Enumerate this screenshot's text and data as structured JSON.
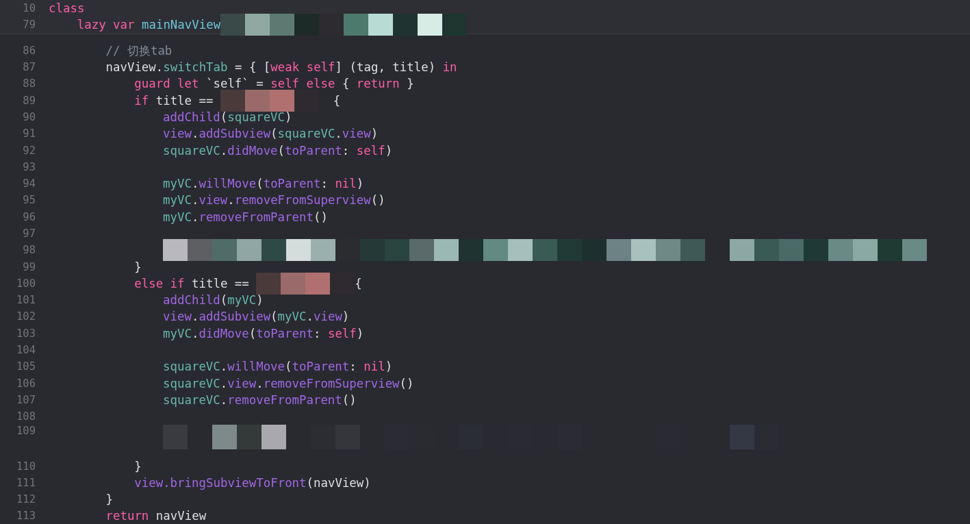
{
  "sticky_lines": [
    {
      "number": "10",
      "tokens": [
        {
          "kind": "kw",
          "text": "class"
        }
      ]
    },
    {
      "number": "79",
      "tokens": [
        {
          "kind": "kw",
          "text": "    lazy var "
        },
        {
          "kind": "blue",
          "text": "mainNavView"
        },
        {
          "kind": "mosaic-medium"
        }
      ]
    }
  ],
  "lines": [
    {
      "number": "86",
      "tokens": [
        {
          "kind": "comment",
          "text": "        // 切换tab"
        }
      ]
    },
    {
      "number": "87",
      "tokens": [
        {
          "kind": "plain",
          "text": "        navView."
        },
        {
          "kind": "teal",
          "text": "switchTab"
        },
        {
          "kind": "plain",
          "text": " = { ["
        },
        {
          "kind": "kw",
          "text": "weak self"
        },
        {
          "kind": "plain",
          "text": "] (tag, title) "
        },
        {
          "kind": "kw",
          "text": "in"
        }
      ]
    },
    {
      "number": "88",
      "tokens": [
        {
          "kind": "kw",
          "text": "            guard let"
        },
        {
          "kind": "plain",
          "text": " `self` = "
        },
        {
          "kind": "kw",
          "text": "self else"
        },
        {
          "kind": "plain",
          "text": " { "
        },
        {
          "kind": "kw",
          "text": "return"
        },
        {
          "kind": "plain",
          "text": " }"
        }
      ]
    },
    {
      "number": "89",
      "tokens": [
        {
          "kind": "kw",
          "text": "            if"
        },
        {
          "kind": "plain",
          "text": " title == "
        },
        {
          "kind": "mosaic-small"
        },
        {
          "kind": "plain",
          "text": "  {"
        }
      ]
    },
    {
      "number": "90",
      "tokens": [
        {
          "kind": "purple",
          "text": "                addChild"
        },
        {
          "kind": "plain",
          "text": "("
        },
        {
          "kind": "teal",
          "text": "squareVC"
        },
        {
          "kind": "plain",
          "text": ")"
        }
      ]
    },
    {
      "number": "91",
      "tokens": [
        {
          "kind": "purple",
          "text": "                view"
        },
        {
          "kind": "plain",
          "text": "."
        },
        {
          "kind": "purple",
          "text": "addSubview"
        },
        {
          "kind": "plain",
          "text": "("
        },
        {
          "kind": "teal",
          "text": "squareVC"
        },
        {
          "kind": "plain",
          "text": "."
        },
        {
          "kind": "purple",
          "text": "view"
        },
        {
          "kind": "plain",
          "text": ")"
        }
      ]
    },
    {
      "number": "92",
      "tokens": [
        {
          "kind": "teal",
          "text": "                squareVC"
        },
        {
          "kind": "plain",
          "text": "."
        },
        {
          "kind": "purple",
          "text": "didMove"
        },
        {
          "kind": "plain",
          "text": "("
        },
        {
          "kind": "purple",
          "text": "toParent"
        },
        {
          "kind": "plain",
          "text": ": "
        },
        {
          "kind": "kw",
          "text": "self"
        },
        {
          "kind": "plain",
          "text": ")"
        }
      ]
    },
    {
      "number": "93"
    },
    {
      "number": "94",
      "tokens": [
        {
          "kind": "teal",
          "text": "                myVC"
        },
        {
          "kind": "plain",
          "text": "."
        },
        {
          "kind": "purple",
          "text": "willMove"
        },
        {
          "kind": "plain",
          "text": "("
        },
        {
          "kind": "purple",
          "text": "toParent"
        },
        {
          "kind": "plain",
          "text": ": "
        },
        {
          "kind": "kw",
          "text": "nil"
        },
        {
          "kind": "plain",
          "text": ")"
        }
      ]
    },
    {
      "number": "95",
      "tokens": [
        {
          "kind": "teal",
          "text": "                myVC"
        },
        {
          "kind": "plain",
          "text": "."
        },
        {
          "kind": "purple",
          "text": "view"
        },
        {
          "kind": "plain",
          "text": "."
        },
        {
          "kind": "purple",
          "text": "removeFromSuperview"
        },
        {
          "kind": "plain",
          "text": "()"
        }
      ]
    },
    {
      "number": "96",
      "tokens": [
        {
          "kind": "teal",
          "text": "                myVC"
        },
        {
          "kind": "plain",
          "text": "."
        },
        {
          "kind": "purple",
          "text": "removeFromParent"
        },
        {
          "kind": "plain",
          "text": "()"
        }
      ]
    },
    {
      "number": "97"
    },
    {
      "number": "98",
      "tokens": [
        {
          "kind": "mosaic-wide"
        }
      ]
    },
    {
      "number": "99",
      "tokens": [
        {
          "kind": "plain",
          "text": "            }"
        }
      ]
    },
    {
      "number": "100",
      "tokens": [
        {
          "kind": "kw",
          "text": "            else if"
        },
        {
          "kind": "plain",
          "text": " title == "
        },
        {
          "kind": "mosaic-small"
        },
        {
          "kind": "plain",
          "text": "{"
        }
      ]
    },
    {
      "number": "101",
      "tokens": [
        {
          "kind": "purple",
          "text": "                addChild"
        },
        {
          "kind": "plain",
          "text": "("
        },
        {
          "kind": "teal",
          "text": "myVC"
        },
        {
          "kind": "plain",
          "text": ")"
        }
      ]
    },
    {
      "number": "102",
      "tokens": [
        {
          "kind": "purple",
          "text": "                view"
        },
        {
          "kind": "plain",
          "text": "."
        },
        {
          "kind": "purple",
          "text": "addSubview"
        },
        {
          "kind": "plain",
          "text": "("
        },
        {
          "kind": "teal",
          "text": "myVC"
        },
        {
          "kind": "plain",
          "text": "."
        },
        {
          "kind": "purple",
          "text": "view"
        },
        {
          "kind": "plain",
          "text": ")"
        }
      ]
    },
    {
      "number": "103",
      "tokens": [
        {
          "kind": "teal",
          "text": "                myVC"
        },
        {
          "kind": "plain",
          "text": "."
        },
        {
          "kind": "purple",
          "text": "didMove"
        },
        {
          "kind": "plain",
          "text": "("
        },
        {
          "kind": "purple",
          "text": "toParent"
        },
        {
          "kind": "plain",
          "text": ": "
        },
        {
          "kind": "kw",
          "text": "self"
        },
        {
          "kind": "plain",
          "text": ")"
        }
      ]
    },
    {
      "number": "104"
    },
    {
      "number": "105",
      "tokens": [
        {
          "kind": "teal",
          "text": "                squareVC"
        },
        {
          "kind": "plain",
          "text": "."
        },
        {
          "kind": "purple",
          "text": "willMove"
        },
        {
          "kind": "plain",
          "text": "("
        },
        {
          "kind": "purple",
          "text": "toParent"
        },
        {
          "kind": "plain",
          "text": ": "
        },
        {
          "kind": "kw",
          "text": "nil"
        },
        {
          "kind": "plain",
          "text": ")"
        }
      ]
    },
    {
      "number": "106",
      "tokens": [
        {
          "kind": "teal",
          "text": "                squareVC"
        },
        {
          "kind": "plain",
          "text": "."
        },
        {
          "kind": "purple",
          "text": "view"
        },
        {
          "kind": "plain",
          "text": "."
        },
        {
          "kind": "purple",
          "text": "removeFromSuperview"
        },
        {
          "kind": "plain",
          "text": "()"
        }
      ]
    },
    {
      "number": "107",
      "tokens": [
        {
          "kind": "teal",
          "text": "                squareVC"
        },
        {
          "kind": "plain",
          "text": "."
        },
        {
          "kind": "purple",
          "text": "removeFromParent"
        },
        {
          "kind": "plain",
          "text": "()"
        }
      ]
    },
    {
      "number": "108"
    },
    {
      "number": "109",
      "tokens": [
        {
          "kind": "mosaic-tall"
        }
      ]
    },
    {
      "number": "110",
      "tokens": [
        {
          "kind": "plain",
          "text": "            }"
        }
      ]
    },
    {
      "number": "111",
      "tokens": [
        {
          "kind": "purple",
          "text": "            view.bringSubviewToFront"
        },
        {
          "kind": "plain",
          "text": "(navView)"
        }
      ]
    },
    {
      "number": "112",
      "tokens": [
        {
          "kind": "plain",
          "text": "        }"
        }
      ]
    },
    {
      "number": "113",
      "tokens": [
        {
          "kind": "kw",
          "text": "        return"
        },
        {
          "kind": "plain",
          "text": " navView"
        }
      ]
    }
  ]
}
